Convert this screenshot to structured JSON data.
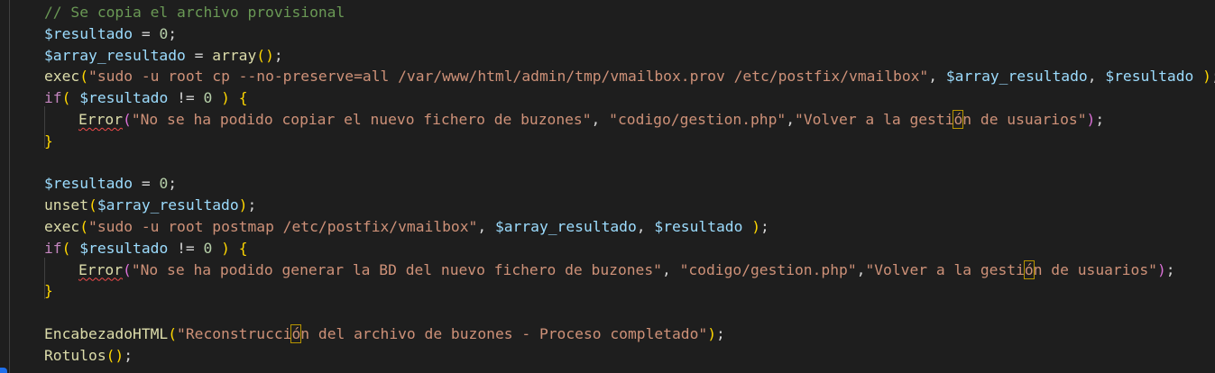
{
  "editor": {
    "language": "php",
    "theme": "dark",
    "lines": [
      {
        "indent": 1,
        "tokens": [
          {
            "t": "cm",
            "v": "// Se copia el archivo provisional"
          }
        ]
      },
      {
        "indent": 1,
        "tokens": [
          {
            "t": "v",
            "v": "$resultado"
          },
          {
            "t": "p",
            "v": " = "
          },
          {
            "t": "n",
            "v": "0"
          },
          {
            "t": "p",
            "v": ";"
          }
        ]
      },
      {
        "indent": 1,
        "tokens": [
          {
            "t": "v",
            "v": "$array_resultado"
          },
          {
            "t": "p",
            "v": " = "
          },
          {
            "t": "f",
            "v": "array"
          },
          {
            "t": "b1",
            "v": "()"
          },
          {
            "t": "p",
            "v": ";"
          }
        ]
      },
      {
        "indent": 1,
        "tokens": [
          {
            "t": "f",
            "v": "exec"
          },
          {
            "t": "b1",
            "v": "("
          },
          {
            "t": "s",
            "v": "\"sudo -u root cp --no-preserve=all /var/www/html/admin/tmp/vmailbox.prov /etc/postfix/vmailbox\""
          },
          {
            "t": "p",
            "v": ", "
          },
          {
            "t": "v",
            "v": "$array_resultado"
          },
          {
            "t": "p",
            "v": ", "
          },
          {
            "t": "v",
            "v": "$resultado"
          },
          {
            "t": "p",
            "v": " "
          },
          {
            "t": "b1",
            "v": ")"
          },
          {
            "t": "p",
            "v": ";"
          }
        ]
      },
      {
        "indent": 1,
        "tokens": [
          {
            "t": "k",
            "v": "if"
          },
          {
            "t": "b1",
            "v": "("
          },
          {
            "t": "p",
            "v": " "
          },
          {
            "t": "v",
            "v": "$resultado"
          },
          {
            "t": "p",
            "v": " != "
          },
          {
            "t": "n",
            "v": "0"
          },
          {
            "t": "p",
            "v": " "
          },
          {
            "t": "b1",
            "v": ")"
          },
          {
            "t": "p",
            "v": " "
          },
          {
            "t": "b1",
            "v": "{"
          }
        ]
      },
      {
        "indent": 2,
        "tokens": [
          {
            "t": "f err",
            "v": "Error"
          },
          {
            "t": "b2",
            "v": "("
          },
          {
            "t": "s",
            "v": "\"No se ha podido copiar el nuevo fichero de buzones\""
          },
          {
            "t": "p",
            "v": ", "
          },
          {
            "t": "s",
            "v": "\"codigo/gestion.php\""
          },
          {
            "t": "p",
            "v": ","
          },
          {
            "t": "s",
            "v": "\"Volver a la gesti"
          },
          {
            "t": "s hl",
            "v": "ó"
          },
          {
            "t": "s",
            "v": "n de usuarios\""
          },
          {
            "t": "b2",
            "v": ")"
          },
          {
            "t": "p",
            "v": ";"
          }
        ]
      },
      {
        "indent": 1,
        "tokens": [
          {
            "t": "b1",
            "v": "}"
          }
        ]
      },
      {
        "indent": 0,
        "tokens": []
      },
      {
        "indent": 1,
        "tokens": [
          {
            "t": "v",
            "v": "$resultado"
          },
          {
            "t": "p",
            "v": " = "
          },
          {
            "t": "n",
            "v": "0"
          },
          {
            "t": "p",
            "v": ";"
          }
        ]
      },
      {
        "indent": 1,
        "tokens": [
          {
            "t": "f",
            "v": "unset"
          },
          {
            "t": "b1",
            "v": "("
          },
          {
            "t": "v",
            "v": "$array_resultado"
          },
          {
            "t": "b1",
            "v": ")"
          },
          {
            "t": "p",
            "v": ";"
          }
        ]
      },
      {
        "indent": 1,
        "tokens": [
          {
            "t": "f",
            "v": "exec"
          },
          {
            "t": "b1",
            "v": "("
          },
          {
            "t": "s",
            "v": "\"sudo -u root postmap /etc/postfix/vmailbox\""
          },
          {
            "t": "p",
            "v": ", "
          },
          {
            "t": "v",
            "v": "$array_resultado"
          },
          {
            "t": "p",
            "v": ", "
          },
          {
            "t": "v",
            "v": "$resultado"
          },
          {
            "t": "p",
            "v": " "
          },
          {
            "t": "b1",
            "v": ")"
          },
          {
            "t": "p",
            "v": ";"
          }
        ]
      },
      {
        "indent": 1,
        "tokens": [
          {
            "t": "k",
            "v": "if"
          },
          {
            "t": "b1",
            "v": "("
          },
          {
            "t": "p",
            "v": " "
          },
          {
            "t": "v",
            "v": "$resultado"
          },
          {
            "t": "p",
            "v": " != "
          },
          {
            "t": "n",
            "v": "0"
          },
          {
            "t": "p",
            "v": " "
          },
          {
            "t": "b1",
            "v": ")"
          },
          {
            "t": "p",
            "v": " "
          },
          {
            "t": "b1",
            "v": "{"
          }
        ]
      },
      {
        "indent": 2,
        "tokens": [
          {
            "t": "f err",
            "v": "Error"
          },
          {
            "t": "b2",
            "v": "("
          },
          {
            "t": "s",
            "v": "\"No se ha podido generar la BD del nuevo fichero de buzones\""
          },
          {
            "t": "p",
            "v": ", "
          },
          {
            "t": "s",
            "v": "\"codigo/gestion.php\""
          },
          {
            "t": "p",
            "v": ","
          },
          {
            "t": "s",
            "v": "\"Volver a la gesti"
          },
          {
            "t": "s hl",
            "v": "ó"
          },
          {
            "t": "s",
            "v": "n de usuarios\""
          },
          {
            "t": "b2",
            "v": ")"
          },
          {
            "t": "p",
            "v": ";"
          }
        ]
      },
      {
        "indent": 1,
        "tokens": [
          {
            "t": "b1",
            "v": "}"
          }
        ]
      },
      {
        "indent": 0,
        "tokens": []
      },
      {
        "indent": 1,
        "tokens": [
          {
            "t": "f",
            "v": "EncabezadoHTML"
          },
          {
            "t": "b1",
            "v": "("
          },
          {
            "t": "s",
            "v": "\"Reconstrucci"
          },
          {
            "t": "s hl",
            "v": "ó"
          },
          {
            "t": "s",
            "v": "n del archivo de buzones - Proceso completado\""
          },
          {
            "t": "b1",
            "v": ")"
          },
          {
            "t": "p",
            "v": ";"
          }
        ]
      },
      {
        "indent": 1,
        "tokens": [
          {
            "t": "f",
            "v": "Rotulos"
          },
          {
            "t": "b1",
            "v": "()"
          },
          {
            "t": "p",
            "v": ";"
          }
        ]
      }
    ]
  }
}
